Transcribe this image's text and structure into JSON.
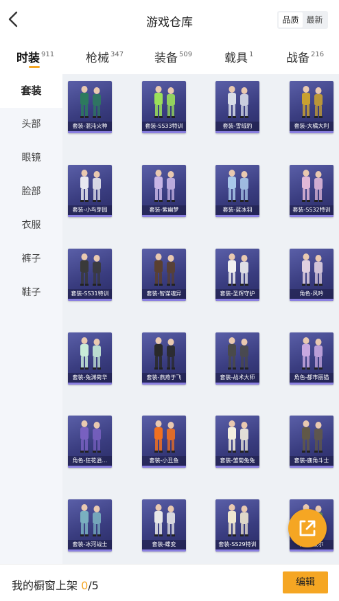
{
  "header": {
    "title": "游戏仓库",
    "sort_options": [
      "品质",
      "最新"
    ],
    "active_sort": 0
  },
  "tabs": [
    {
      "label": "时装",
      "count": "911"
    },
    {
      "label": "枪械",
      "count": "347"
    },
    {
      "label": "装备",
      "count": "509"
    },
    {
      "label": "载具",
      "count": "1"
    },
    {
      "label": "战备",
      "count": "216"
    }
  ],
  "sidebar": {
    "items": [
      "套装",
      "头部",
      "眼镜",
      "脸部",
      "衣服",
      "裤子",
      "鞋子"
    ]
  },
  "items": [
    {
      "label": "套装-混沌火种",
      "accent": "#2d7a5e"
    },
    {
      "label": "套装-SS33特训",
      "accent": "#9be05a"
    },
    {
      "label": "套装-雪绒豹",
      "accent": "#d8dde8"
    },
    {
      "label": "套装-大橘大利",
      "accent": "#c8a030"
    },
    {
      "label": "套装-小鸟芽园",
      "accent": "#e8e8f0"
    },
    {
      "label": "套装-紫幽梦",
      "accent": "#c9b6e6"
    },
    {
      "label": "套装-蓝冰羽",
      "accent": "#a9c8ea"
    },
    {
      "label": "套装-SS32特训",
      "accent": "#e0b8d8"
    },
    {
      "label": "套装-SS31特训",
      "accent": "#3a3a3a"
    },
    {
      "label": "套装-智谋魂异",
      "accent": "#5a4030"
    },
    {
      "label": "套装-圣辉守护",
      "accent": "#f0f0f0"
    },
    {
      "label": "角色-风吟",
      "accent": "#e0d0e0"
    },
    {
      "label": "套装-兔渊荷华",
      "accent": "#c8ecd8"
    },
    {
      "label": "套装-燕燕于飞",
      "accent": "#2a2a2a"
    },
    {
      "label": "套装-战术大师",
      "accent": "#4a4a4a"
    },
    {
      "label": "角色-都市丽猫",
      "accent": "#c8a8e0"
    },
    {
      "label": "角色-狂花逍…",
      "accent": "#7860c0"
    },
    {
      "label": "套装-小丑鱼",
      "accent": "#f07020"
    },
    {
      "label": "套装-雏菊兔兔",
      "accent": "#f4f0e0"
    },
    {
      "label": "套装-鹿角斗士",
      "accent": "#605848"
    },
    {
      "label": "套装-冰河战士",
      "accent": "#7ab0c0"
    },
    {
      "label": "套装-蝶变",
      "accent": "#e8e8e8"
    },
    {
      "label": "套装-SS29特训",
      "accent": "#f0e8d0"
    },
    {
      "label": "角色-波尔",
      "accent": "#6a9050"
    }
  ],
  "footer": {
    "text": "我的橱窗上架 ",
    "count": "0",
    "total": "/5",
    "edit_label": "编辑"
  },
  "colors": {
    "accent": "#f5a623",
    "sidebar_bg": "#f4f6fa",
    "content_bg": "#eef1f5"
  }
}
